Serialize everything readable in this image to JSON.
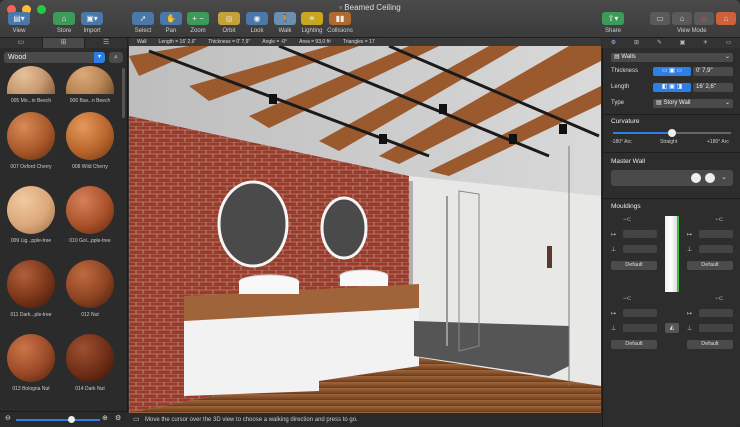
{
  "window": {
    "title": "Beamed Ceiling"
  },
  "toolbar": {
    "view": "View",
    "store": "Store",
    "import": "Import",
    "select": "Select",
    "pan": "Pan",
    "zoom": "Zoom",
    "orbit": "Orbit",
    "look": "Look",
    "walk": "Walk",
    "lighting": "Lighting",
    "collisions": "Collisions",
    "share": "Share",
    "view_mode": "View Mode"
  },
  "infobar": {
    "type": "Wall",
    "length": "Length = 16' 2,6\"",
    "thickness": "Thickness = 0' 7,9\"",
    "angle": "Angle = -0°",
    "area": "Area = 93,0 ft²",
    "triangles": "Triangles = 17"
  },
  "library": {
    "category": "Wood",
    "materials": [
      {
        "name": "005 Mo...in Beech",
        "color": "#c79a72"
      },
      {
        "name": "006 Bav...n Beech",
        "color": "#b98755"
      },
      {
        "name": "007 Oxford Cherry",
        "color": "#a8582a"
      },
      {
        "name": "008 Wild Cherry",
        "color": "#b8652c"
      },
      {
        "name": "009 Lig...pple-tree",
        "color": "#d9a77a"
      },
      {
        "name": "010 Gol...pple-tree",
        "color": "#a9512a"
      },
      {
        "name": "011 Dark...ple-tree",
        "color": "#7a3518"
      },
      {
        "name": "012 Nut",
        "color": "#8c4322"
      },
      {
        "name": "013 Bologna Nut",
        "color": "#9a4a28"
      },
      {
        "name": "014 Dark Nut",
        "color": "#6f2e16"
      }
    ]
  },
  "status": {
    "hint": "Move the cursor over the 3D view to choose a walking direction and press to go."
  },
  "inspector": {
    "object": "Walls",
    "thickness_label": "Thickness",
    "thickness_value": "0' 7,9\"",
    "length_label": "Length",
    "length_value": "16' 2,6\"",
    "type_label": "Type",
    "type_value": "Story Wall",
    "curvature_label": "Curvature",
    "curv_min": "-180° Arc",
    "curv_mid": "Straight",
    "curv_max": "+180° Arc",
    "curvature_fraction": 0.5,
    "master_wall_label": "Master Wall",
    "mouldings_label": "Mouldings",
    "default_label": "Default"
  },
  "colors": {
    "accent": "#2f7ee6",
    "brick": "#9a3a2a",
    "wood_beam": "#9a5a2e"
  }
}
